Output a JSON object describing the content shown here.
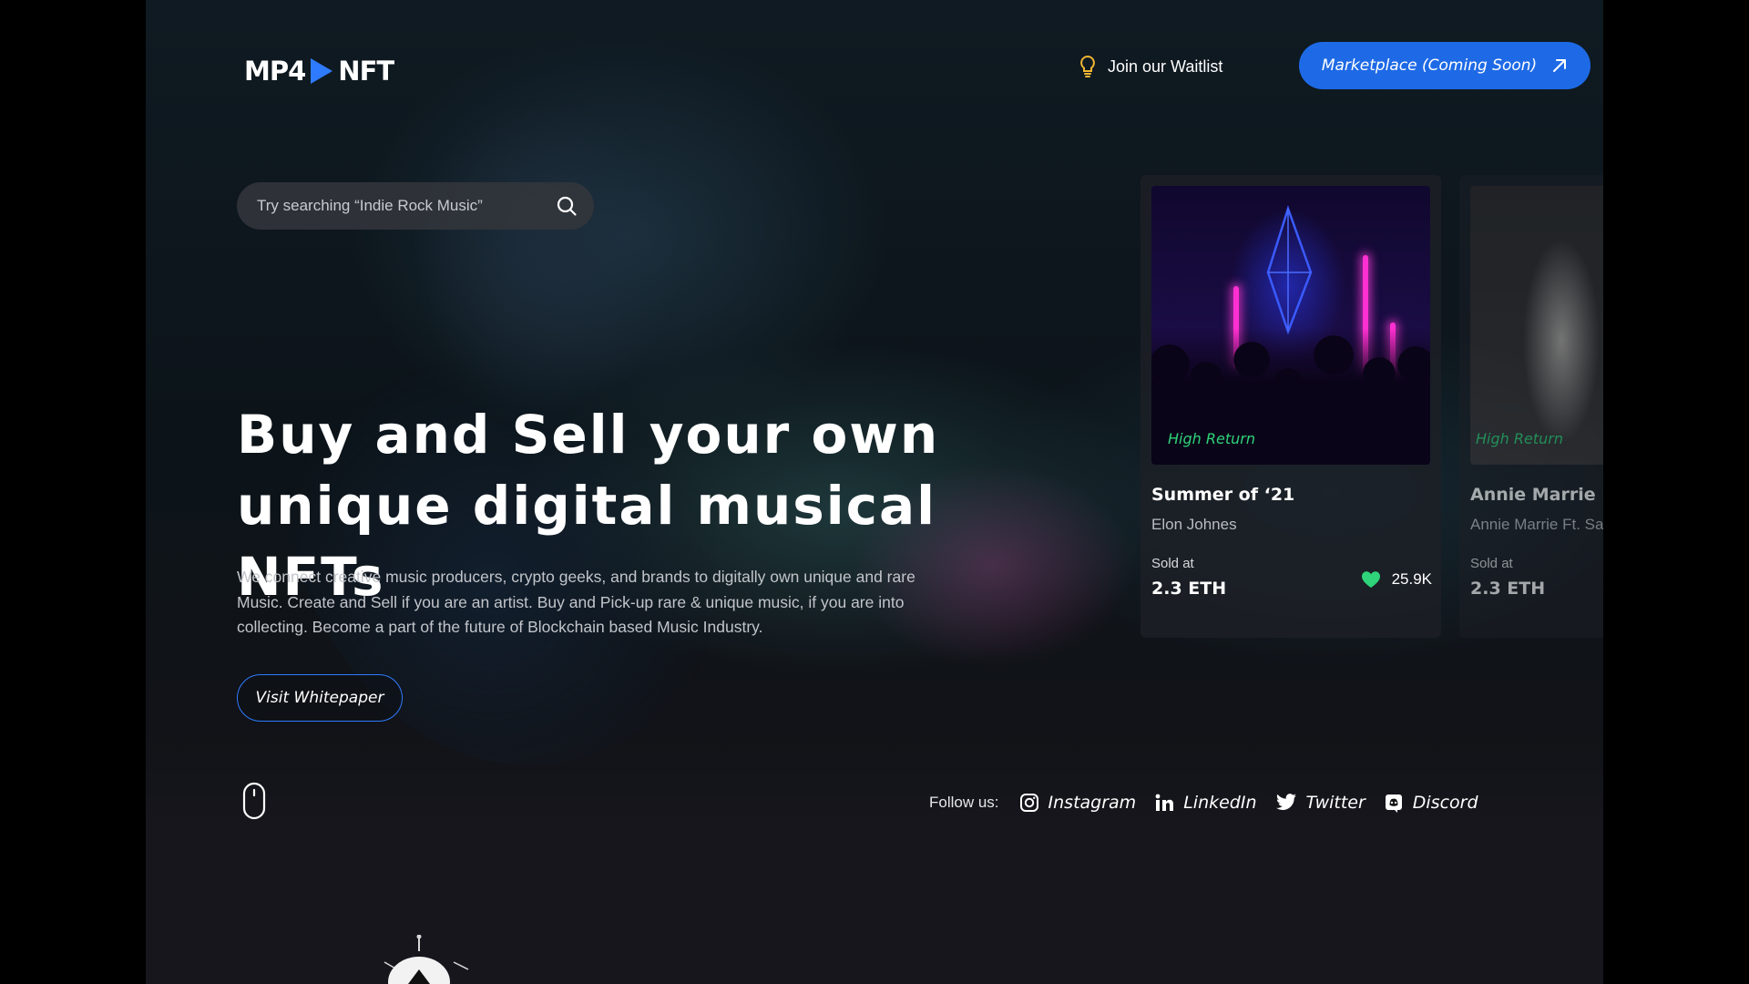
{
  "header": {
    "logo": {
      "left": "MP4",
      "right": "NFT"
    },
    "waitlist_label": "Join our Waitlist",
    "marketplace_label": "Marketplace (Coming Soon)"
  },
  "search": {
    "placeholder": "Try searching “Indie Rock Music”"
  },
  "hero": {
    "title_line1": "Buy and Sell your own",
    "title_line2": "unique digital musical NFTs",
    "description": "We connect creative music producers, crypto geeks, and brands to digitally own unique and rare Music. Create and Sell if you are an artist. Buy and Pick-up rare & unique music, if you are into collecting. Become a part of the future of Blockchain based Music Industry.",
    "cta_label": "Visit Whitepaper"
  },
  "cards": [
    {
      "badge": "High Return",
      "title": "Summer of ‘21",
      "artist": "Elon Johnes",
      "sold_label": "Sold at",
      "price": "2.3 ETH",
      "likes": "25.9K"
    },
    {
      "badge": "High Return",
      "title": "Annie Marrie Ft. Sandy",
      "artist": "Annie Marrie Ft. Sandy",
      "sold_label": "Sold at",
      "price": "2.3 ETH"
    }
  ],
  "footer": {
    "follow_label": "Follow us:",
    "socials": [
      {
        "label": "Instagram",
        "icon": "instagram-icon"
      },
      {
        "label": "LinkedIn",
        "icon": "linkedin-icon"
      },
      {
        "label": "Twitter",
        "icon": "twitter-icon"
      },
      {
        "label": "Discord",
        "icon": "discord-icon"
      }
    ]
  },
  "colors": {
    "accent_blue": "#1e6ae6",
    "badge_green": "#2fd37a",
    "heart_green": "#2fd37a",
    "waitlist_icon": "#f2b632"
  }
}
